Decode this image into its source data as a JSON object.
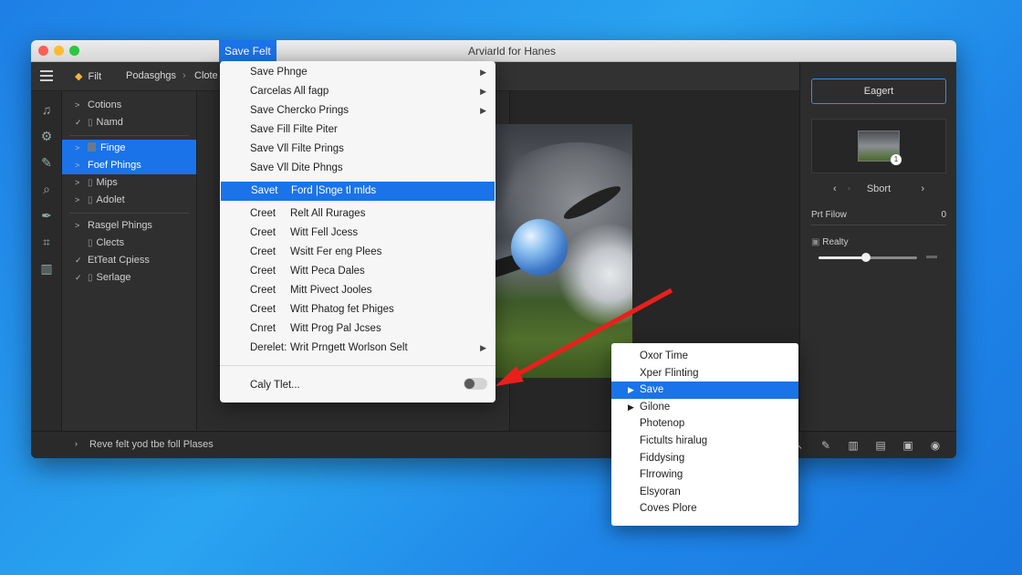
{
  "window": {
    "title": "Arviarld for Hanes",
    "menu_tab": "Save Felt"
  },
  "toolbar": {
    "edit_label": "Filt",
    "breadcrumb_1": "Podasghgs",
    "breadcrumb_2": "Clote"
  },
  "sidebar": {
    "items": [
      {
        "chevron": ">",
        "label": "Cotions",
        "selected": false
      },
      {
        "chevron": "✓",
        "label": "Namd",
        "selected": false,
        "box": true
      },
      {
        "chevron": ">",
        "label": "Finge",
        "selected": true,
        "thumb": true
      },
      {
        "chevron": ">",
        "label": "Foef Phings",
        "selected": true
      },
      {
        "chevron": ">",
        "label": "Mips",
        "selected": false,
        "box": true
      },
      {
        "chevron": ">",
        "label": "Adolet",
        "selected": false,
        "box": true
      },
      {
        "chevron": ">",
        "label": "Rasgel Phings",
        "selected": false
      },
      {
        "chevron": "",
        "label": "Clects",
        "selected": false,
        "box": true
      },
      {
        "chevron": "✓",
        "label": "EtTeat Cpiess",
        "selected": false
      },
      {
        "chevron": "✓",
        "label": "Serlage",
        "selected": false,
        "box": true
      }
    ]
  },
  "menu1": {
    "group1": [
      {
        "label": "Save Phnge",
        "submenu": true
      },
      {
        "label": "Carcelas All fagp",
        "submenu": true
      },
      {
        "label": "Save Chercko Prings",
        "submenu": true
      },
      {
        "label": "Save Fill Filte Piter",
        "submenu": false
      },
      {
        "label": "Save Vll Filte Prings",
        "submenu": false
      },
      {
        "label": "Save Vll Dite Phngs",
        "submenu": false
      }
    ],
    "selected": {
      "cmd": "Savet",
      "label": "Ford |Snge tl mlds"
    },
    "group2": [
      {
        "cmd": "Creet",
        "label": "Relt All Rurages",
        "submenu": false
      },
      {
        "cmd": "Creet",
        "label": "Witt Fell Jcess",
        "submenu": false
      },
      {
        "cmd": "Creet",
        "label": "Wsitt Fer eng Plees",
        "submenu": false
      },
      {
        "cmd": "Creet",
        "label": "Witt Peca Dales",
        "submenu": false
      },
      {
        "cmd": "Creet",
        "label": "Mitt Pivect Jooles",
        "submenu": false
      },
      {
        "cmd": "Creet",
        "label": "Witt Phatog fet Phiges",
        "submenu": false
      },
      {
        "cmd": "Cnret",
        "label": "Witt Prog Pal Jcses",
        "submenu": false
      },
      {
        "cmd": "Derelet:",
        "label": "Writ Prngett Worlson Selt",
        "submenu": true
      }
    ],
    "footer_label": "Caly Tlet...",
    "footer_toggle_on": false
  },
  "menu2": {
    "items": [
      {
        "label": "Oxor Time",
        "tri": false,
        "selected": false
      },
      {
        "label": "Xper Flinting",
        "tri": false,
        "selected": false
      },
      {
        "label": "Save",
        "tri": true,
        "selected": true
      },
      {
        "label": "Gilone",
        "tri": true,
        "selected": false
      },
      {
        "label": "Photenop",
        "tri": false,
        "selected": false
      },
      {
        "label": "Fictults hiralug",
        "tri": false,
        "selected": false
      },
      {
        "label": "Fiddysing",
        "tri": false,
        "selected": false
      },
      {
        "label": "Flrrowing",
        "tri": false,
        "selected": false
      },
      {
        "label": "Elsyoran",
        "tri": false,
        "selected": false
      },
      {
        "label": "Coves Plore",
        "tri": false,
        "selected": false
      }
    ]
  },
  "rightpanel": {
    "export_label": "Eagert",
    "thumb_badge": "1",
    "sort_label": "Sbort",
    "row1_label": "Prt Filow",
    "row1_value": "0",
    "row2_label": "Realty",
    "slider_value": 0.48
  },
  "statusbar": {
    "text": "Reve felt yod tbe foll Plases"
  },
  "colors": {
    "accent": "#1a73e8",
    "annotation_arrow": "#e8201c"
  }
}
